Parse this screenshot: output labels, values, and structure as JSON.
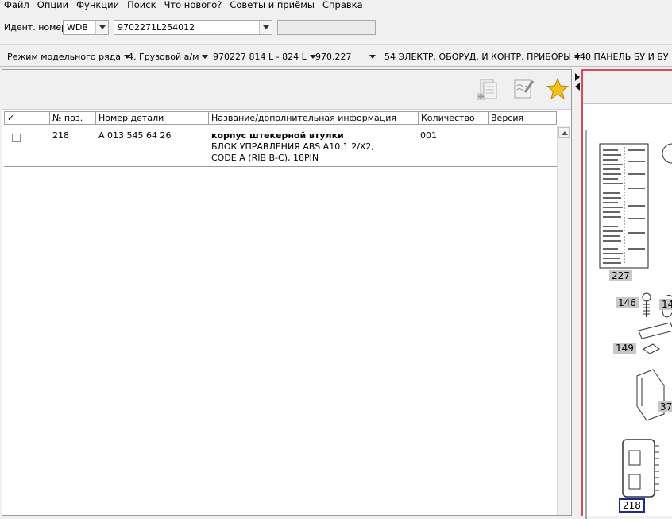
{
  "menu": [
    "Файл",
    "Опции",
    "Функции",
    "Поиск",
    "Что нового?",
    "Советы и приёмы",
    "Справка"
  ],
  "ident": {
    "label": "Идент. номер",
    "prefix": "WDB",
    "number": "9702271L254012",
    "extra": ""
  },
  "breadcrumb": [
    "Режим модельного ряда",
    "4. Грузовой а/м",
    "970227 814 L - 824 L",
    "970.227",
    "54 ЭЛЕКТР. ОБОРУД. И КОНТР. ПРИБОРЫ",
    "440 ПАНЕЛЬ БУ И БУ"
  ],
  "toolbar_icons": [
    "add-to-list-icon",
    "notes-icon",
    "favorite-star-icon"
  ],
  "table": {
    "headers": [
      "✓",
      "№ поз.",
      "Номер детали",
      "Название/дополнительная информация",
      "Количество",
      "Версия"
    ],
    "rows": [
      {
        "checked": false,
        "pos": "218",
        "part": "A 013 545 64 26",
        "name": "корпус штекерной втулки",
        "info1": "БЛОК УПРАВЛЕНИЯ ABS A10.1.2/X2,",
        "info2": "CODE A (RIB B-C), 18PIN",
        "qty": "001",
        "version": ""
      }
    ]
  },
  "diagram": {
    "labels": [
      "227",
      "146",
      "14",
      "149",
      "37",
      "218"
    ]
  },
  "colors": {
    "selection_border": "#d9485f",
    "highlight_box": "#1a2a9a"
  }
}
